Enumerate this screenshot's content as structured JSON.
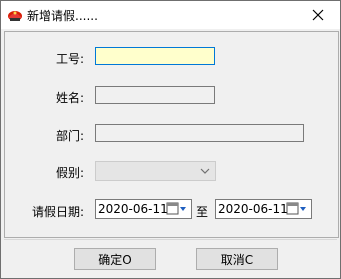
{
  "window": {
    "title": "新增请假......"
  },
  "form": {
    "employee_id_label": "工号:",
    "employee_id_value": "",
    "name_label": "姓名:",
    "name_value": "",
    "department_label": "部门:",
    "department_value": "",
    "leave_type_label": "假别:",
    "leave_type_value": "",
    "leave_date_label": "请假日期:",
    "date_from": "2020-06-11",
    "date_to_label": "至",
    "date_to": "2020-06-11"
  },
  "buttons": {
    "ok_label": "确定O",
    "cancel_label": "取消C"
  },
  "icons": {
    "app": "red-helmet-icon",
    "close": "close-icon",
    "dropdown": "chevron-down-icon",
    "calendar": "calendar-icon"
  }
}
